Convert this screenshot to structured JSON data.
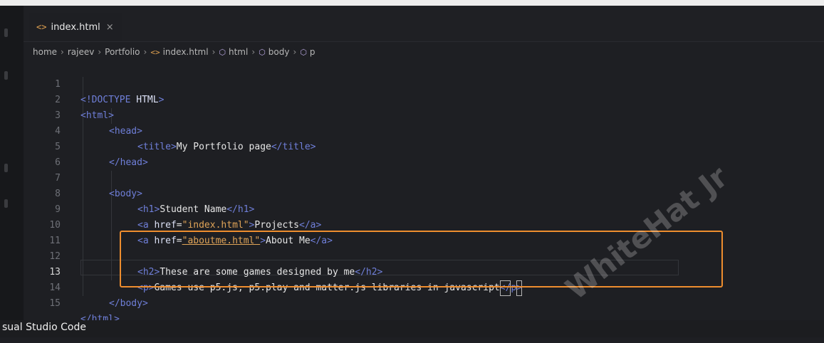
{
  "tab": {
    "icon": "html-file-icon",
    "label": "index.html",
    "close": "×"
  },
  "breadcrumb": [
    {
      "label": "home",
      "icon": null
    },
    {
      "label": "rajeev",
      "icon": null
    },
    {
      "label": "Portfolio",
      "icon": null
    },
    {
      "label": "index.html",
      "icon": "<>"
    },
    {
      "label": "html",
      "icon": "⬡"
    },
    {
      "label": "body",
      "icon": "⬡"
    },
    {
      "label": "p",
      "icon": "⬡"
    }
  ],
  "line_numbers": [
    "1",
    "2",
    "3",
    "4",
    "5",
    "6",
    "7",
    "8",
    "9",
    "10",
    "11",
    "12",
    "13",
    "14",
    "15"
  ],
  "code": {
    "l1": {
      "open": "<!",
      "keyword": "DOCTYPE",
      "name": "HTML",
      "close": ">"
    },
    "l2": {
      "tag": "<html>"
    },
    "l3": {
      "tag": "<head>"
    },
    "l4": {
      "open": "<title>",
      "text": "My Portfolio page",
      "close": "</title>"
    },
    "l5": {
      "tag": "</head>"
    },
    "l7": {
      "tag": "<body>"
    },
    "l8": {
      "open": "<h1>",
      "text": "Student Name",
      "close": "</h1>"
    },
    "l9": {
      "open": "<a",
      "attr": " href",
      "eq": "=",
      "value": "\"index.html\"",
      "gt": ">",
      "text": "Projects",
      "close": "</a>"
    },
    "l10": {
      "open": "<a",
      "attr": " href",
      "eq": "=",
      "value": "\"aboutme.html\"",
      "gt": ">",
      "text": "About Me",
      "close": "</a>"
    },
    "l12": {
      "open": "<h2>",
      "text": "These are some games designed by me",
      "close": "</h2>"
    },
    "l13": {
      "open": "<p>",
      "text": "Games use p5.js, p5.play and matter.js libraries in javascript",
      "close_a": "</",
      "close_b": "p",
      "close_c": ">"
    },
    "l14": {
      "tag": "</body>"
    },
    "l15": {
      "tag": "</html>"
    }
  },
  "status": {
    "app_name": "sual Studio Code"
  },
  "watermark": "WhiteHat Jr",
  "colors": {
    "highlight_box": "#ee8d2e",
    "tag": "#6f7fd9",
    "string": "#e0a458"
  }
}
